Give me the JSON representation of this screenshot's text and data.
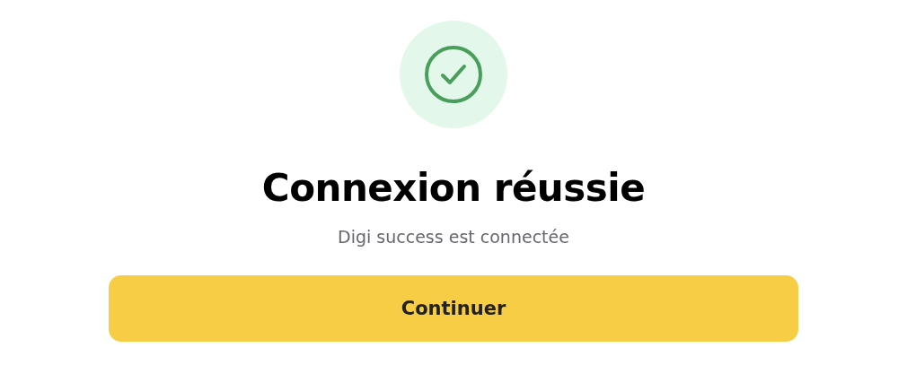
{
  "title": "Connexion réussie",
  "subtitle": "Digi success est connectée",
  "button": {
    "label": "Continuer"
  }
}
